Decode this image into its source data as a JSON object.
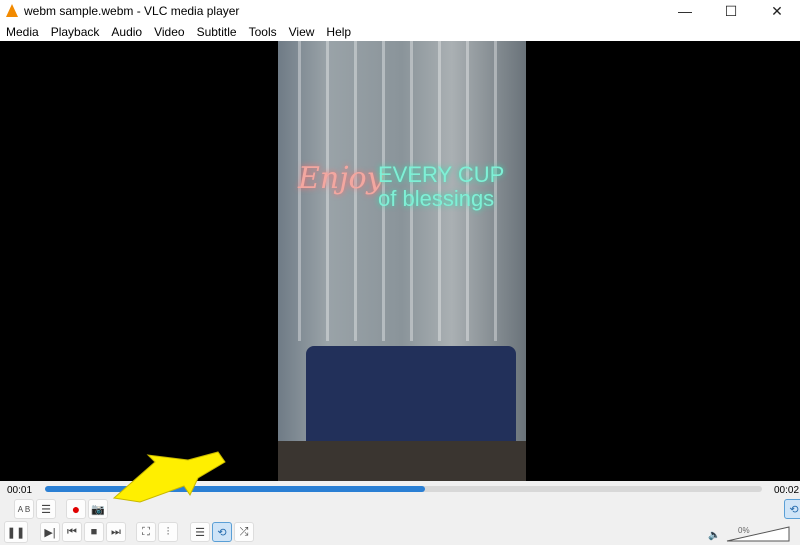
{
  "window": {
    "title": "webm sample.webm - VLC media player",
    "minimize": "—",
    "maximize": "☐",
    "close": "✕"
  },
  "menu": [
    "Media",
    "Playback",
    "Audio",
    "Video",
    "Subtitle",
    "Tools",
    "View",
    "Help"
  ],
  "video": {
    "neon_line1": "Enjoy",
    "neon_line2": "EVERY CUP",
    "neon_line3": "of blessings"
  },
  "playback": {
    "elapsed": "00:01",
    "total": "00:02",
    "progress_percent": 53
  },
  "controls": {
    "ab_loop": "A B",
    "pause": "❚❚",
    "frame": "▶|",
    "prev": "⏮",
    "stop": "■",
    "next": "⏭",
    "fullscreen": "⛶",
    "extended": "⫶",
    "playlist": "☰",
    "loop": "⟲",
    "shuffle": "⤮",
    "record": "●",
    "snapshot": "📷",
    "speaker": "🔈"
  },
  "volume": {
    "label": "0%",
    "value_percent": 0
  },
  "colors": {
    "accent": "#2a7fd4",
    "record": "#e00000",
    "annotation_arrow": "#ffef00"
  }
}
